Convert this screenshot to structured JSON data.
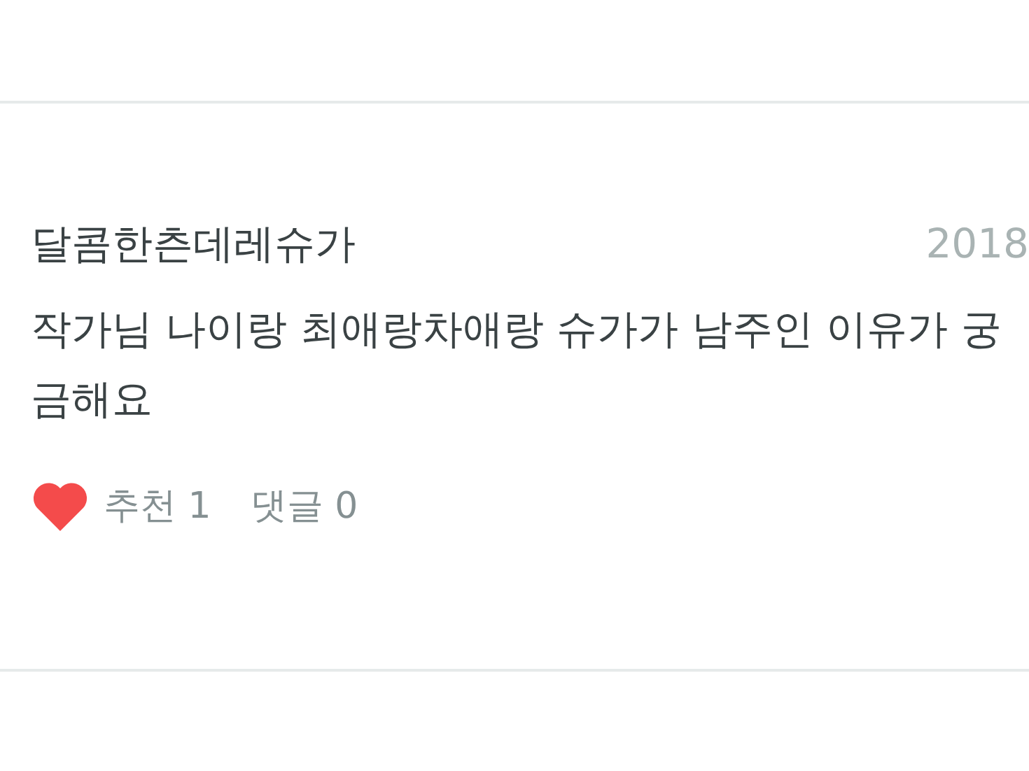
{
  "comment": {
    "author": "달콤한츤데레슈가",
    "date": "2018",
    "body": "작가님 나이랑 최애랑차애랑 슈가가 남주인 이유가 궁금해요",
    "liked": true,
    "likes_label": "추천",
    "likes_count": "1",
    "replies_label": "댓글",
    "replies_count": "0"
  }
}
